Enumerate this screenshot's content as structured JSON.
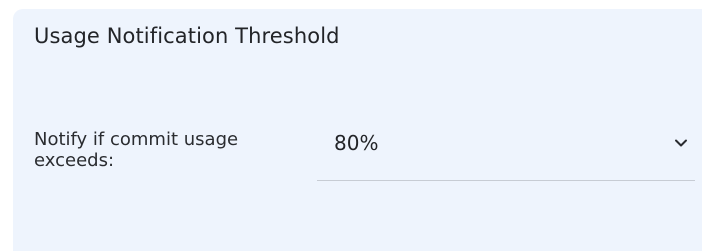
{
  "card": {
    "title": "Usage Notification Threshold"
  },
  "threshold_field": {
    "label": "Notify if commit usage exceeds:",
    "selected_value": "80%",
    "icon": "chevron-down-icon"
  },
  "colors": {
    "card_background": "#eef4fd",
    "text": "#222428",
    "underline": "#c7ccd4"
  }
}
